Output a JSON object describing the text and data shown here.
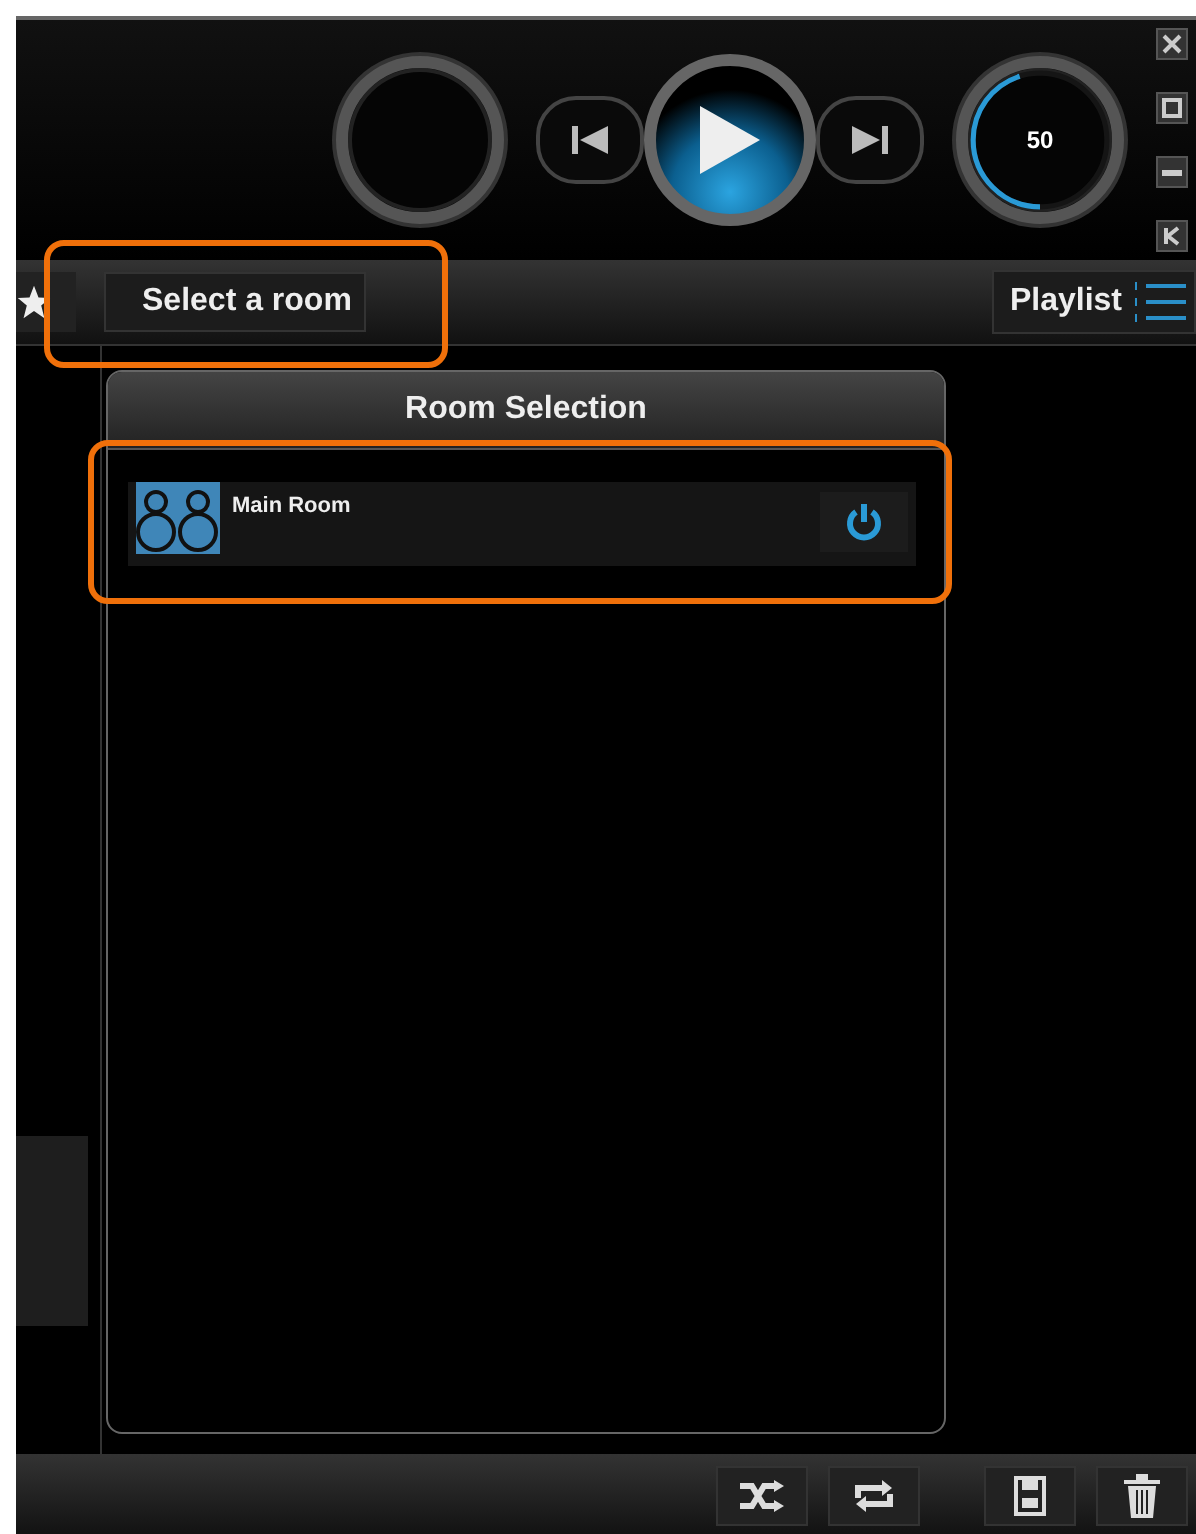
{
  "player": {
    "volume": {
      "reading": "50",
      "level": 0.45
    }
  },
  "toolbar": {
    "room_button": "Select a room",
    "playlist_button": "Playlist"
  },
  "room_selection": {
    "title": "Room Selection",
    "rooms": [
      {
        "name": "Main Room",
        "on": true
      }
    ]
  }
}
